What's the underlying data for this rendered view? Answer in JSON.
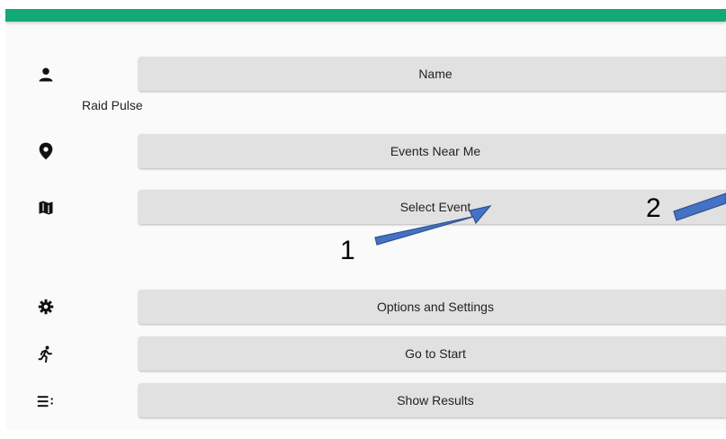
{
  "header": {
    "accent_color": "#12a877"
  },
  "menu": {
    "name": {
      "label": "Name",
      "icon": "person-icon",
      "subtext": "Raid Pulse"
    },
    "events_near_me": {
      "label": "Events Near Me",
      "icon": "location-pin-icon"
    },
    "select_event": {
      "label": "Select Event",
      "icon": "map-icon"
    },
    "options_settings": {
      "label": "Options and Settings",
      "icon": "gear-icon"
    },
    "go_to_start": {
      "label": "Go to Start",
      "icon": "running-person-icon"
    },
    "show_results": {
      "label": "Show Results",
      "icon": "list-icon"
    }
  },
  "annotations": {
    "label_1": "1",
    "label_2": "2",
    "arrow_color": "#4472c4"
  }
}
